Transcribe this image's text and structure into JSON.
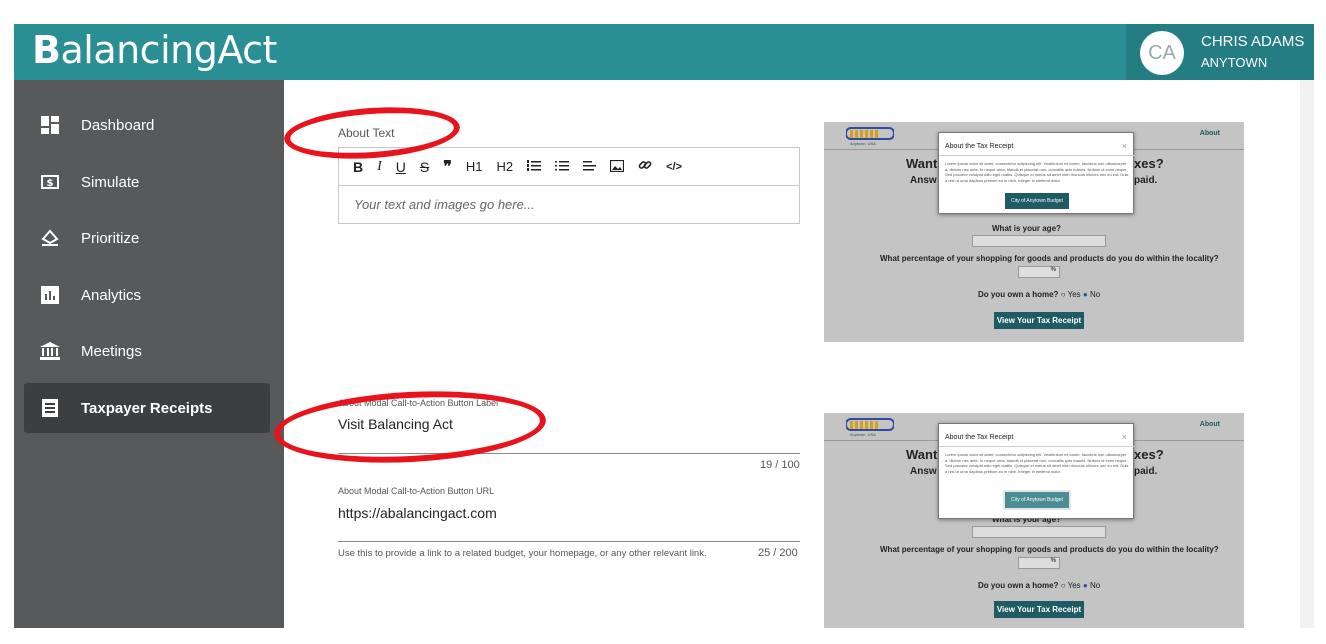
{
  "header": {
    "logo_first": "B",
    "logo_rest": "alancingAct",
    "user_initials": "CA",
    "user_name": "CHRIS ADAMS",
    "user_town": "ANYTOWN"
  },
  "sidebar": {
    "items": [
      {
        "label": "Dashboard",
        "icon": "dashboard-icon"
      },
      {
        "label": "Simulate",
        "icon": "dollar-icon"
      },
      {
        "label": "Prioritize",
        "icon": "scale-icon"
      },
      {
        "label": "Analytics",
        "icon": "chart-icon"
      },
      {
        "label": "Meetings",
        "icon": "building-icon"
      },
      {
        "label": "Taxpayer Receipts",
        "icon": "receipt-icon",
        "active": true
      }
    ]
  },
  "form": {
    "about_text_label": "About Text",
    "toolbar": [
      "B",
      "I",
      "U",
      "S",
      "❞",
      "H1",
      "H2",
      "ol",
      "ul",
      "align",
      "image",
      "link",
      "code"
    ],
    "editor_placeholder": "Your text and images go here...",
    "cta_label_label": "About Modal Call-to-Action Button Label",
    "cta_label_value": "Visit Balancing Act",
    "cta_label_count": "19 / 100",
    "cta_url_label": "About Modal Call-to-Action Button URL",
    "cta_url_value": "https://abalancingact.com",
    "cta_url_hint": "Use this to provide a link to a related budget, your homepage, or any other relevant link.",
    "cta_url_count": "25 / 200"
  },
  "preview": {
    "logo_text": "Anytown, USA",
    "nav_about": "About",
    "heading_1": "Want",
    "heading_1b": "xes?",
    "heading_2": "Answ",
    "heading_2b": "paid.",
    "age_q": "What is your age?",
    "pct_q": "What percentage of your shopping for goods and products do you do within the locality?",
    "pct_unit": "%",
    "home_q": "Do you own a home?",
    "yes": "Yes",
    "no": "No",
    "view_btn": "View Your Tax Receipt",
    "modal_title": "About the Tax Receipt",
    "modal_close": "×",
    "modal_body": "Lorem ipsum dolor sit amet, consectetur adipiscing elit. Vestibulum mi lorem, faucibus non ullamcorper a, dictum nec ante. In neque urna, blandit et placerat non, convallis quis mauris. Nullam ut enim neque. Sed posuere volutpat odio eget mattis. Quisque et metus sit amet nibh rhoncus ultrices nec eu est. Duis a nisl ut urna dapibus pretium eu in nibh. Integer in eleifend dolor.",
    "modal_btn": "City of Anytown Budget"
  }
}
